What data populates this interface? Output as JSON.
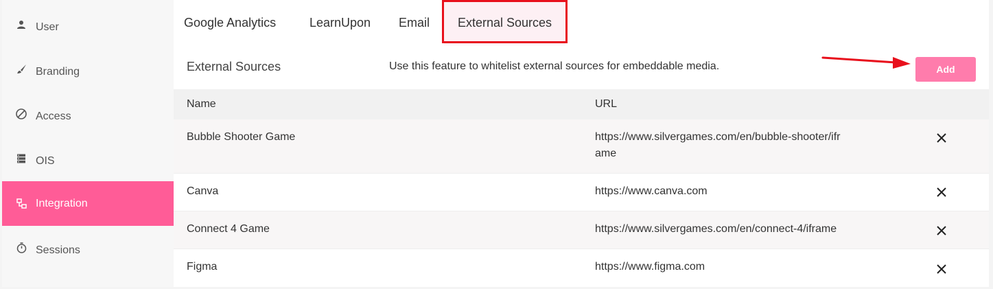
{
  "sidebar": {
    "items": [
      {
        "label": "User",
        "icon": "user-icon"
      },
      {
        "label": "Branding",
        "icon": "brush-icon"
      },
      {
        "label": "Access",
        "icon": "block-icon"
      },
      {
        "label": "OIS",
        "icon": "server-icon"
      },
      {
        "label": "Integration",
        "icon": "integration-icon",
        "active": true
      },
      {
        "label": "Sessions",
        "icon": "timer-icon"
      }
    ]
  },
  "tabs": [
    {
      "label": "Google Analytics"
    },
    {
      "label": "LearnUpon"
    },
    {
      "label": "Email"
    },
    {
      "label": "External Sources",
      "active": true
    }
  ],
  "section": {
    "title": "External Sources",
    "description": "Use this feature to whitelist external sources for embeddable media.",
    "add_label": "Add"
  },
  "table": {
    "headers": {
      "name": "Name",
      "url": "URL"
    },
    "rows": [
      {
        "name": "Bubble Shooter Game",
        "url": "https://www.silvergames.com/en/bubble-shooter/iframe"
      },
      {
        "name": "Canva",
        "url": "https://www.canva.com"
      },
      {
        "name": "Connect 4 Game",
        "url": "https://www.silvergames.com/en/connect-4/iframe"
      },
      {
        "name": "Figma",
        "url": "https://www.figma.com"
      }
    ]
  },
  "colors": {
    "accent": "#ff5c97",
    "add_button": "#ff7cac",
    "highlight": "#e8101c"
  }
}
